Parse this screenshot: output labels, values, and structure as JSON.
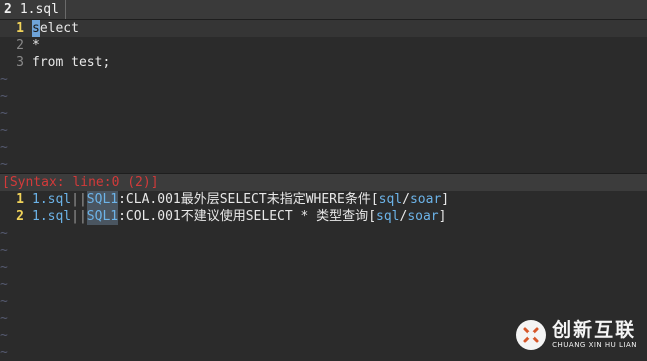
{
  "tabline": {
    "count": "2",
    "name": "1.sql"
  },
  "editor": {
    "lines": [
      {
        "num": "1",
        "cursor_char": "s",
        "text": "elect",
        "current": true
      },
      {
        "num": "2",
        "text": "*"
      },
      {
        "num": "3",
        "text": "from test;"
      }
    ],
    "filler": "~",
    "filler_count": 6
  },
  "status": {
    "message": "[Syntax: line:0 (2)]"
  },
  "quickfix": {
    "lines": [
      {
        "num": "1",
        "file": "1.sql",
        "sep": "||",
        "sev": "SQL1",
        "code": ":CLA.001",
        "msg": "最外层SELECT未指定WHERE条件",
        "src_open": "[",
        "src1": "sql",
        "src_slash": "/",
        "src2": "soar",
        "src_close": "]",
        "current": true
      },
      {
        "num": "2",
        "file": "1.sql",
        "sep": "||",
        "sev": "SQL1",
        "code": ":COL.001",
        "msg": "不建议使用SELECT * 类型查询",
        "src_open": "[",
        "src1": "sql",
        "src_slash": "/",
        "src2": "soar",
        "src_close": "]"
      }
    ],
    "filler": "~",
    "filler_count": 8
  },
  "watermark": {
    "cn": "创新互联",
    "en": "CHUANG XIN HU LIAN"
  }
}
